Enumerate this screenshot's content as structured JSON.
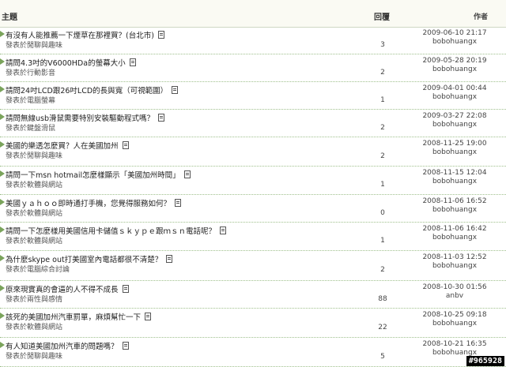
{
  "header": {
    "topic": "主題",
    "replies": "回覆",
    "author": "作者"
  },
  "rows": [
    {
      "title": "有沒有人能推薦一下煙草在那裡買？(台北市)",
      "forum": "發表於閒聊與趣味",
      "replies": "3",
      "date": "2009-06-10 21:17",
      "author": "bobohuangx"
    },
    {
      "title": "請問4.3吋的V6000HDa的螢幕大小",
      "forum": "發表於行動影音",
      "replies": "2",
      "date": "2009-05-28 20:19",
      "author": "bobohuangx"
    },
    {
      "title": "請問24吋LCD跟26吋LCD的長與寬（可視範圍）",
      "forum": "發表於電腦螢幕",
      "replies": "1",
      "date": "2009-04-01 00:44",
      "author": "bobohuangx"
    },
    {
      "title": "請問無線usb滑鼠需要特別安裝驅動程式嗎？",
      "forum": "發表於鍵盤滑鼠",
      "replies": "2",
      "date": "2009-03-27 22:08",
      "author": "bobohuangx"
    },
    {
      "title": "美國的樂透怎麼買？人在美國加州",
      "forum": "發表於閒聊與趣味",
      "replies": "2",
      "date": "2008-11-25 19:00",
      "author": "bobohuangx"
    },
    {
      "title": "請問一下msn hotmail怎麼樣顯示「美國加州時間」",
      "forum": "發表於軟體與網站",
      "replies": "1",
      "date": "2008-11-15 12:04",
      "author": "bobohuangx"
    },
    {
      "title": "美國ｙａｈｏｏ即時通打手機，您覺得服務如何？",
      "forum": "發表於軟體與網站",
      "replies": "0",
      "date": "2008-11-06 16:52",
      "author": "bobohuangx"
    },
    {
      "title": "請問一下怎麼樣用美國信用卡儲值ｓｋｙｐｅ跟ｍｓｎ電話呢？",
      "forum": "發表於軟體與網站",
      "replies": "1",
      "date": "2008-11-06 16:42",
      "author": "bobohuangx"
    },
    {
      "title": "為什麼skype out打美國室內電話都很不清楚？",
      "forum": "發表於電腦綜合討論",
      "replies": "2",
      "date": "2008-11-03 12:52",
      "author": "bobohuangx"
    },
    {
      "title": "原來現實真的會逼的人不得不成長",
      "forum": "發表於兩性與感情",
      "replies": "88",
      "date": "2008-10-30 01:56",
      "author": "anbv"
    },
    {
      "title": "該死的美國加州汽車罰單，麻煩幫忙一下",
      "forum": "發表於軟體與網站",
      "replies": "22",
      "date": "2008-10-25 09:18",
      "author": "bobohuangx"
    },
    {
      "title": "有人知道美國加州汽車的問題嗎？",
      "forum": "發表於閒聊與趣味",
      "replies": "5",
      "date": "2008-10-21 16:35",
      "author": "bobohuangx"
    }
  ],
  "watermark": "#965928"
}
